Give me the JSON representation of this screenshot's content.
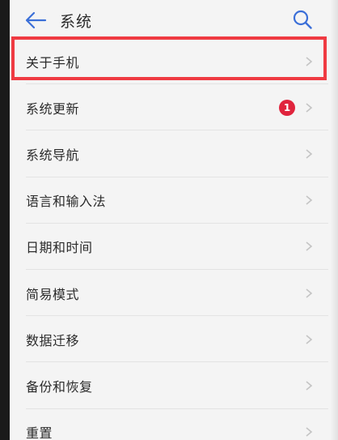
{
  "header": {
    "title": "系统",
    "back_icon": "arrow-left-icon",
    "search_icon": "search-icon"
  },
  "items": [
    {
      "label": "关于手机"
    },
    {
      "label": "系统更新",
      "badge": "1"
    },
    {
      "label": "系统导航"
    },
    {
      "label": "语言和输入法"
    },
    {
      "label": "日期和时间"
    },
    {
      "label": "简易模式"
    },
    {
      "label": "数据迁移"
    },
    {
      "label": "备份和恢复"
    },
    {
      "label": "重置"
    }
  ],
  "colors": {
    "accent": "#3b6fd8",
    "badge": "#e0243d",
    "highlight": "#ef3a42",
    "background": "#f4f4f4"
  }
}
